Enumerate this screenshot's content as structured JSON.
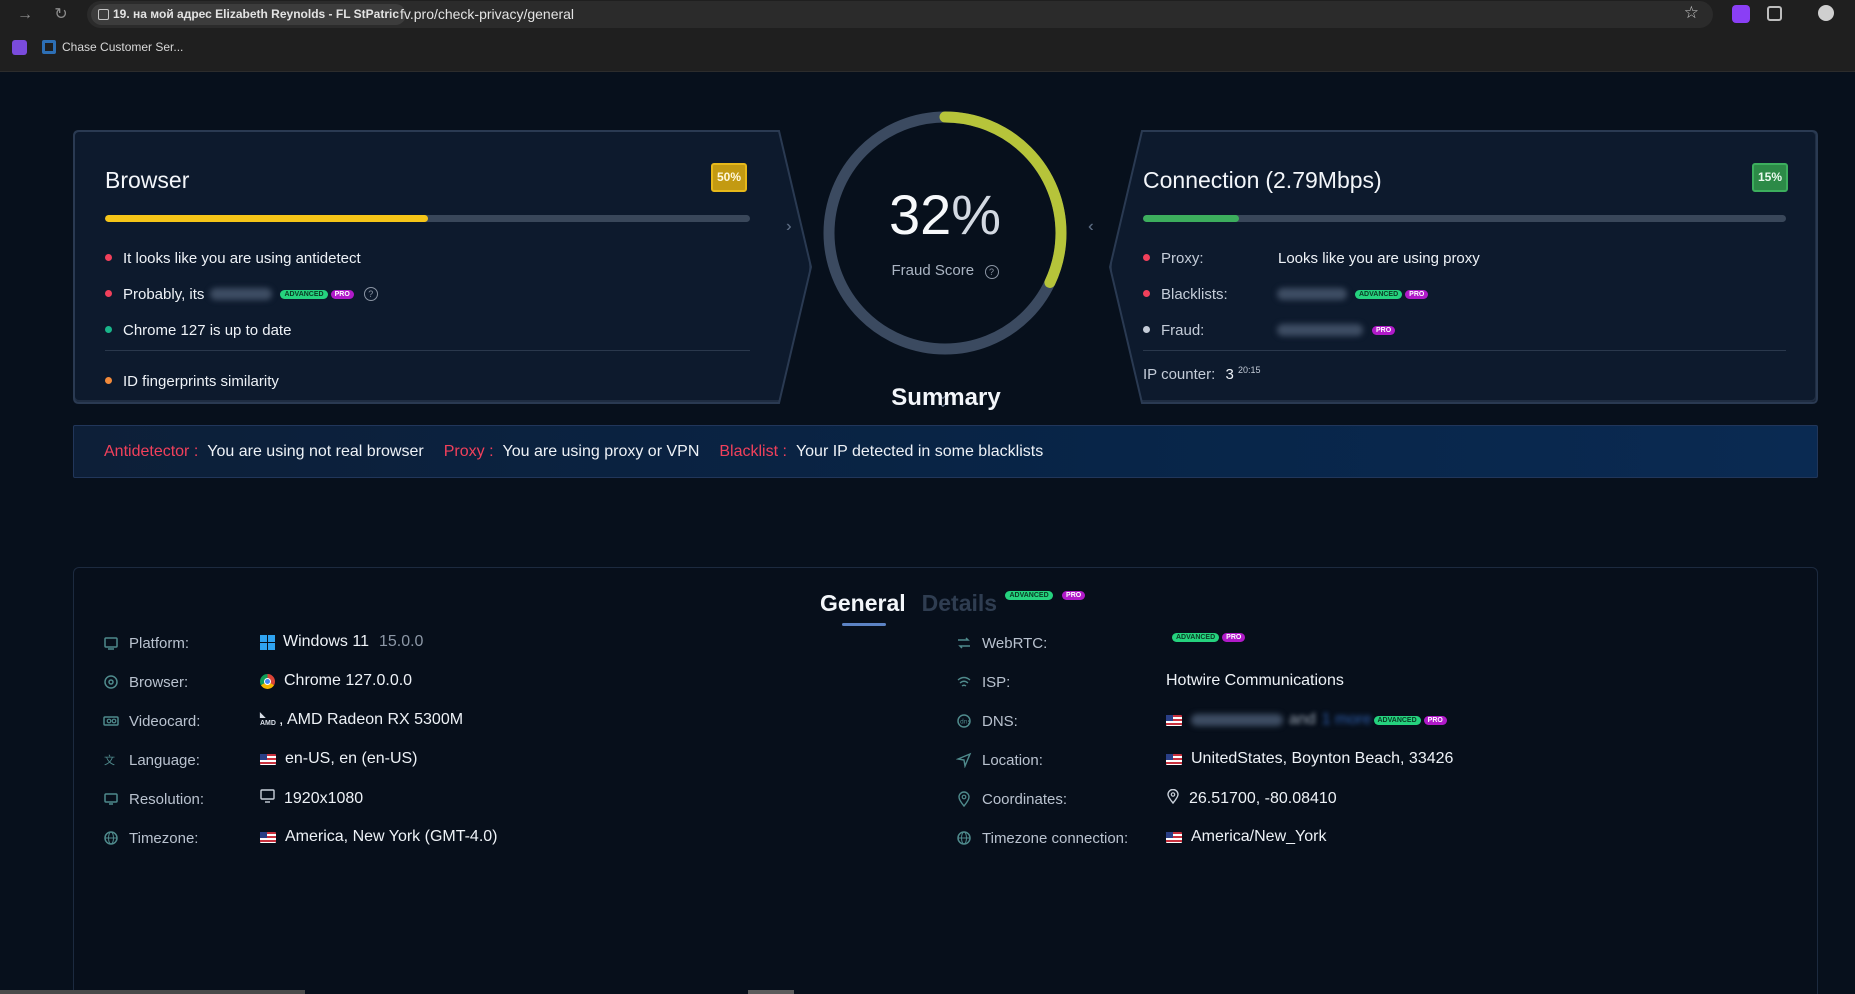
{
  "browser": {
    "tab_title": "19. на мой адрес Elizabeth Reynolds - FL StPatric",
    "url": "fv.pro/check-privacy/general",
    "bookmark": "Chase Customer Ser..."
  },
  "colors": {
    "accent_red": "#f1405b",
    "accent_green": "#3cae5d",
    "accent_yellow": "#f5c518",
    "gauge": "#b6c43a",
    "pro": "#b01ac9",
    "advanced": "#25d27e"
  },
  "browser_panel": {
    "title": "Browser",
    "badge": "50%",
    "progress": 0.5,
    "items": [
      {
        "text": "It looks like you are using antidetect",
        "color": "#f1405b"
      },
      {
        "text": "Probably, its",
        "color": "#f1405b"
      },
      {
        "text": "Chrome 127 is up to date",
        "color": "#19b58a"
      }
    ],
    "similarity": "ID fingerprints similarity"
  },
  "score": {
    "value": "32",
    "unit": "%",
    "label": "Fraud Score",
    "fraction": 0.32
  },
  "connection_panel": {
    "title": "Connection",
    "speed": "(2.79Mbps)",
    "badge": "15%",
    "progress": 0.15,
    "proxy_label": "Proxy:",
    "proxy_value": "Looks like you are using proxy",
    "blacklists_label": "Blacklists:",
    "fraud_label": "Fraud:",
    "ip_counter_label": "IP counter:",
    "ip_counter_value": "3",
    "ip_counter_time": "20:15"
  },
  "tags": {
    "advanced": "ADVANCED",
    "pro": "PRO"
  },
  "summary": {
    "title": "Summary",
    "items": [
      {
        "key": "Antidetector :",
        "value": "You are using not real browser"
      },
      {
        "key": "Proxy :",
        "value": "You are using proxy or VPN"
      },
      {
        "key": "Blacklist :",
        "value": "Your IP detected in some blacklists"
      }
    ]
  },
  "tabs": {
    "general": "General",
    "details": "Details"
  },
  "general_left": [
    {
      "icon": "platform-icon",
      "label": "Platform:",
      "value": "Windows 11",
      "extra": "15.0.0",
      "vicon": "windows-logo-icon"
    },
    {
      "icon": "browser-icon",
      "label": "Browser:",
      "value": "Chrome 127.0.0.0",
      "vicon": "chrome-logo-icon"
    },
    {
      "icon": "videocard-icon",
      "label": "Videocard:",
      "value": ", AMD Radeon RX 5300M",
      "vicon": "amd-logo-icon"
    },
    {
      "icon": "language-icon",
      "label": "Language:",
      "value": "en-US, en (en-US)",
      "vicon": "us-flag-icon"
    },
    {
      "icon": "resolution-icon",
      "label": "Resolution:",
      "value": "1920x1080",
      "vicon": "monitor-icon"
    },
    {
      "icon": "timezone-icon",
      "label": "Timezone:",
      "value": "America, New York (GMT-4.0)",
      "vicon": "us-flag-icon"
    }
  ],
  "general_right": [
    {
      "icon": "webrtc-icon",
      "label": "WebRTC:",
      "value": ""
    },
    {
      "icon": "isp-icon",
      "label": "ISP:",
      "value": "Hotwire Communications"
    },
    {
      "icon": "dns-icon",
      "label": "DNS:",
      "value": "",
      "and": "and",
      "more": "1 more"
    },
    {
      "icon": "location-icon",
      "label": "Location:",
      "value": "UnitedStates, Boynton Beach, 33426"
    },
    {
      "icon": "coordinates-icon",
      "label": "Coordinates:",
      "value": "26.51700, -80.08410"
    },
    {
      "icon": "timezone-connection-icon",
      "label": "Timezone connection:",
      "value": "America/New_York"
    }
  ]
}
